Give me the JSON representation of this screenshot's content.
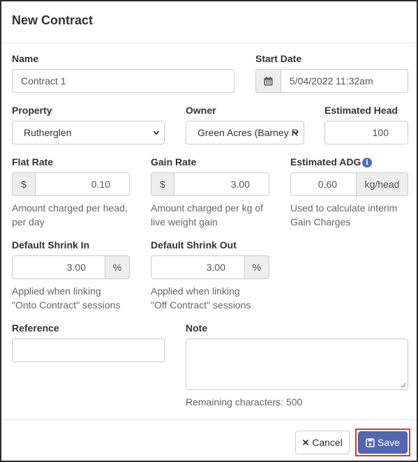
{
  "modal": {
    "title": "New Contract"
  },
  "name": {
    "label": "Name",
    "value": "Contract 1"
  },
  "start_date": {
    "label": "Start Date",
    "value": "5/04/2022 11:32am",
    "icon": "calendar-icon"
  },
  "property": {
    "label": "Property",
    "value": "Rutherglen"
  },
  "owner": {
    "label": "Owner",
    "value": "Green Acres (Barney R"
  },
  "estimated_head": {
    "label": "Estimated Head",
    "value": "100"
  },
  "flat_rate": {
    "label": "Flat Rate",
    "prefix": "$",
    "value": "0.10",
    "help_line1": "Amount charged per head,",
    "help_line2": "per day"
  },
  "gain_rate": {
    "label": "Gain Rate",
    "prefix": "$",
    "value": "3.00",
    "help_line1": "Amount charged per kg of",
    "help_line2": "live weight gain"
  },
  "estimated_adg": {
    "label": "Estimated ADG",
    "value": "0.60",
    "suffix": "kg/head",
    "help_line1": "Used to calculate interim",
    "help_line2": "Gain Charges",
    "info_icon": "i"
  },
  "shrink_in": {
    "label": "Default Shrink In",
    "value": "3.00",
    "suffix": "%",
    "help_line1": "Applied when linking",
    "help_line2": "\"Onto Contract\" sessions"
  },
  "shrink_out": {
    "label": "Default Shrink Out",
    "value": "3.00",
    "suffix": "%",
    "help_line1": "Applied when linking",
    "help_line2": "\"Off Contract\" sessions"
  },
  "reference": {
    "label": "Reference",
    "value": ""
  },
  "note": {
    "label": "Note",
    "value": "",
    "remaining": "Remaining characters: 500"
  },
  "footer": {
    "cancel_label": "Cancel",
    "save_label": "Save"
  },
  "colors": {
    "primary": "#5266b3",
    "highlight": "#d33a2c",
    "info": "#4a6fb5"
  }
}
